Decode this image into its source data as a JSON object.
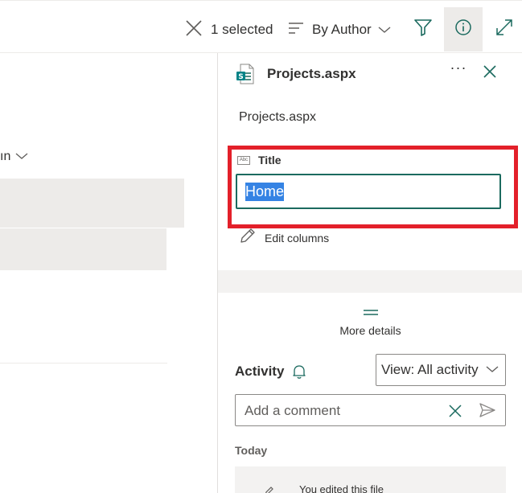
{
  "toolbar": {
    "selection_label": "1 selected",
    "sort_label": "By Author"
  },
  "list": {
    "column_header_fragment": "ın"
  },
  "details_pane": {
    "file_title": "Projects.aspx",
    "file_name": "Projects.aspx",
    "field": {
      "label": "Title",
      "value": "Home"
    },
    "edit_columns_label": "Edit columns",
    "more_details_label": "More details",
    "activity": {
      "label": "Activity",
      "view_select_value": "View: All activity",
      "comment_placeholder": "Add a comment",
      "today_label": "Today",
      "first_item_text": "You edited this file"
    }
  },
  "colors": {
    "highlight": "#e3202a",
    "input_border": "#1b6a5f",
    "selection": "#3583e4",
    "active_button_bg": "#edebe9"
  }
}
